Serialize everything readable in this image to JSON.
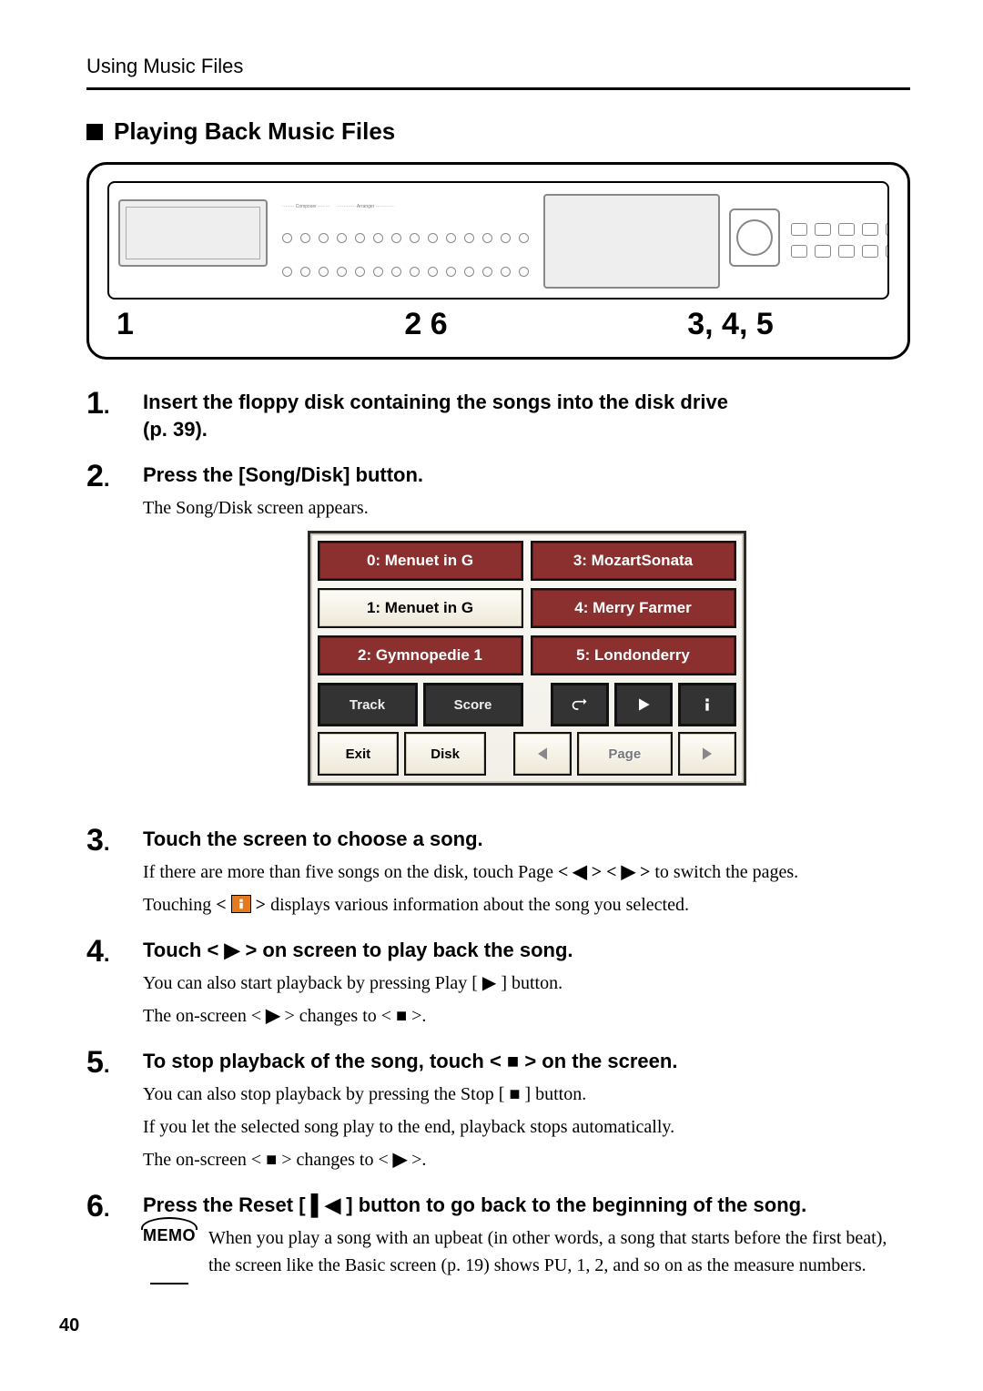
{
  "running_head": "Using Music Files",
  "section_title": "Playing Back Music Files",
  "callouts": {
    "c1": "1",
    "c2": "2  6",
    "c3": "3, 4, 5"
  },
  "steps": {
    "s1": {
      "num": "1",
      "head_a": "Insert the floppy disk containing the songs into the disk drive",
      "head_b": "(p. 39)."
    },
    "s2": {
      "num": "2",
      "head": "Press the [Song/Disk] button.",
      "body": "The Song/Disk screen appears."
    },
    "s3": {
      "num": "3",
      "head": "Touch the screen to choose a song.",
      "body1_a": "If there are more than five songs on the disk, touch Page ",
      "body1_b": " to switch the pages.",
      "body2_a": "Touching ",
      "body2_b": " displays various information about the song you selected."
    },
    "s4": {
      "num": "4",
      "head_a": "Touch < ",
      "head_b": " > on screen to play back the song.",
      "body1_a": "You can also start playback by pressing Play [ ",
      "body1_b": " ] button.",
      "body2_a": "The on-screen < ",
      "body2_b": " > changes to < ",
      "body2_c": " >."
    },
    "s5": {
      "num": "5",
      "head_a": "To stop playback of the song, touch < ",
      "head_b": " > on the screen.",
      "body1_a": "You can also stop playback by pressing the Stop [ ",
      "body1_b": " ] button.",
      "body2": "If you let the selected song play to the end, playback stops automatically.",
      "body3_a": "The on-screen < ",
      "body3_b": " > changes to < ",
      "body3_c": " >."
    },
    "s6": {
      "num": "6",
      "head_a": "Press the Reset [ ",
      "head_b": " ] button to go back to the beginning of the song."
    }
  },
  "memo": {
    "label": "MEMO",
    "text": "When you play a song with an upbeat (in other words, a song that starts before the first beat), the screen like the Basic screen (p. 19) shows PU, 1, 2, and so on as the measure numbers."
  },
  "screenshot": {
    "songs_left": [
      "0: Menuet in G",
      "1: Menuet in G",
      "2: Gymnopedie 1"
    ],
    "songs_right": [
      "3: MozartSonata",
      "4: Merry Farmer",
      "5: Londonderry"
    ],
    "row1": {
      "track": "Track",
      "score": "Score"
    },
    "row2": {
      "exit": "Exit",
      "disk": "Disk",
      "page": "Page"
    }
  },
  "icons": {
    "tri_left": "◀",
    "tri_right": "▶",
    "play": "▶",
    "stop": "■",
    "reset": "⏮",
    "reset_left": "▌◀"
  },
  "page_number": "40"
}
